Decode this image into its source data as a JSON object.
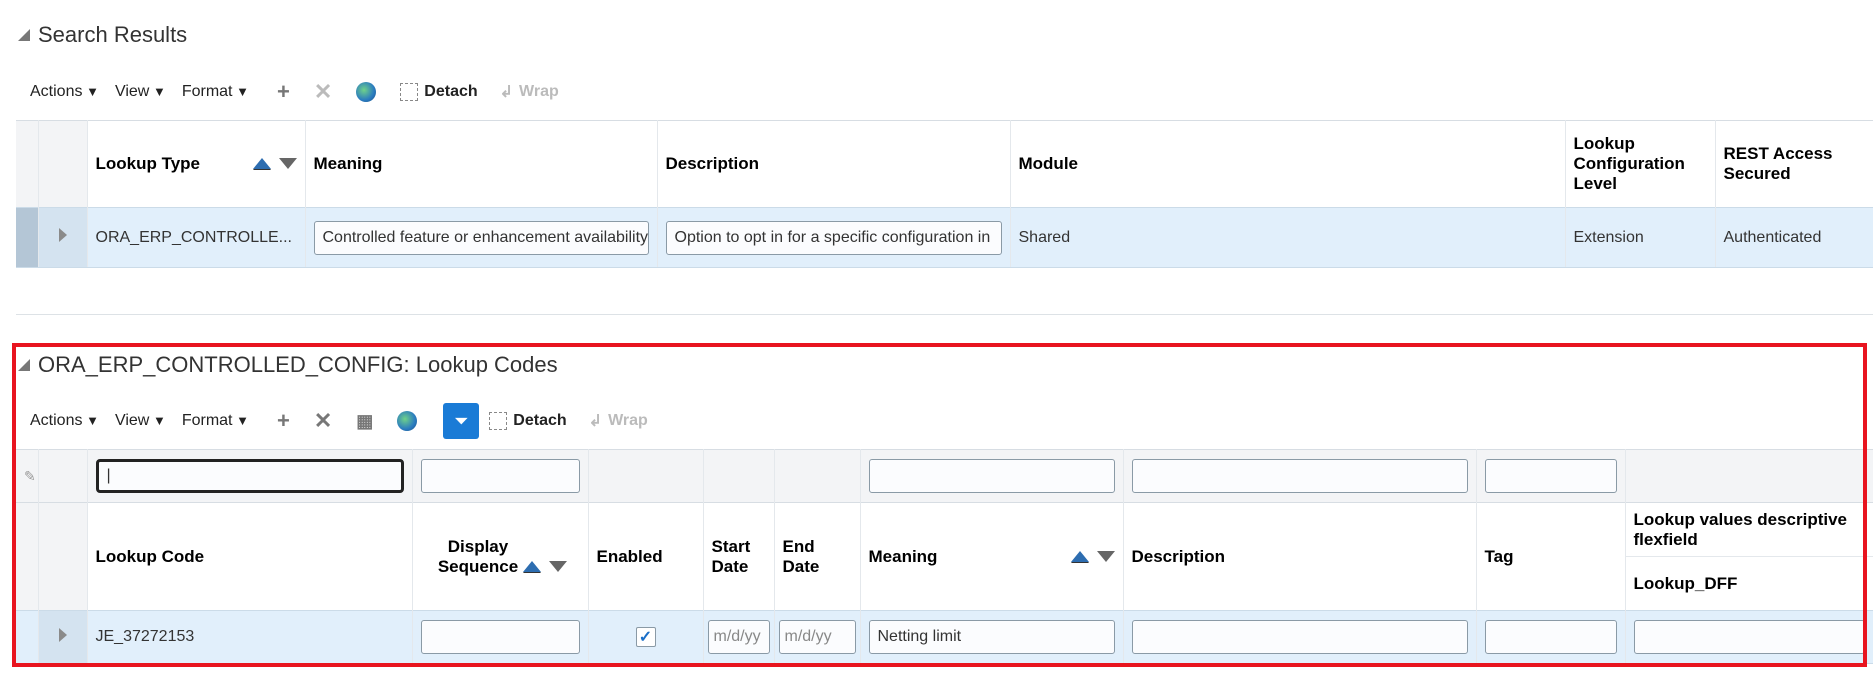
{
  "search_results": {
    "title": "Search Results",
    "toolbar": {
      "actions": "Actions",
      "view": "View",
      "format": "Format",
      "detach": "Detach",
      "wrap": "Wrap"
    },
    "columns": [
      "Lookup Type",
      "Meaning",
      "Description",
      "Module",
      "Lookup Configuration Level",
      "REST Access Secured"
    ],
    "rows": [
      {
        "lookup_type": "ORA_ERP_CONTROLLE...",
        "meaning": "Controlled feature or enhancement availability",
        "description": "Option to opt in for a specific configuration in",
        "module": "Shared",
        "config_level": "Extension",
        "rest_access": "Authenticated"
      }
    ]
  },
  "lookup_codes": {
    "title": "ORA_ERP_CONTROLLED_CONFIG: Lookup Codes",
    "toolbar": {
      "actions": "Actions",
      "view": "View",
      "format": "Format",
      "detach": "Detach",
      "wrap": "Wrap"
    },
    "columns": {
      "lookup_code": "Lookup Code",
      "display_sequence": "Display Sequence",
      "enabled": "Enabled",
      "start_date": "Start Date",
      "end_date": "End Date",
      "meaning": "Meaning",
      "description": "Description",
      "tag": "Tag",
      "dff_group": "Lookup values descriptive flexfield",
      "dff": "Lookup_DFF"
    },
    "date_placeholder": "m/d/yy",
    "rows": [
      {
        "lookup_code": "JE_37272153",
        "display_sequence": "",
        "enabled": true,
        "start_date": "",
        "end_date": "",
        "meaning": "Netting limit",
        "description": "",
        "tag": "",
        "dff": ""
      }
    ]
  },
  "colors": {
    "accent": "#1a7bd6",
    "highlight": "#e8141f",
    "row_selected": "#e1effb"
  }
}
